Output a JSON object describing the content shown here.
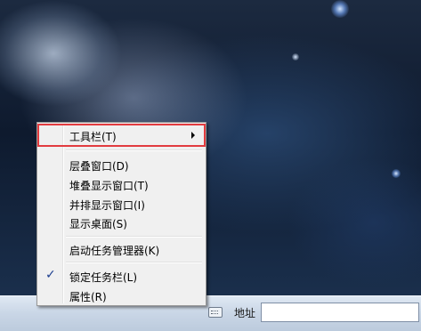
{
  "context_menu": {
    "items": [
      {
        "label": "工具栏(T)",
        "submenu": true,
        "highlighted": true
      },
      {
        "label": "层叠窗口(D)"
      },
      {
        "label": "堆叠显示窗口(T)"
      },
      {
        "label": "并排显示窗口(I)"
      },
      {
        "label": "显示桌面(S)"
      },
      {
        "label": "启动任务管理器(K)"
      },
      {
        "label": "锁定任务栏(L)",
        "checked": true
      },
      {
        "label": "属性(R)"
      }
    ],
    "check_mark": "✓",
    "highlight_color": "#e23b3f"
  },
  "taskbar": {
    "address_label": "地址",
    "address_value": "",
    "keyboard_icon": "keyboard-icon"
  }
}
